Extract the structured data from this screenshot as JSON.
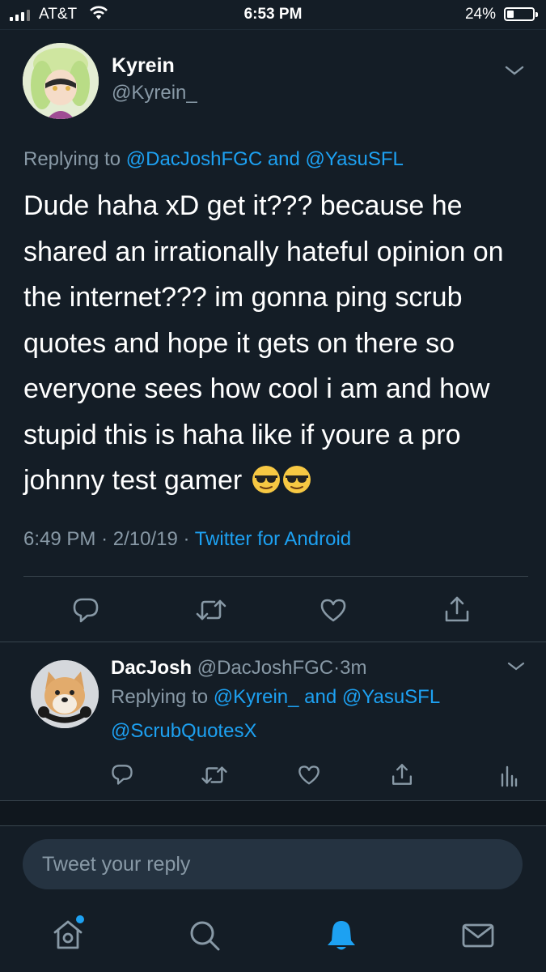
{
  "status_bar": {
    "carrier": "AT&T",
    "time": "6:53 PM",
    "battery": "24%"
  },
  "tweet": {
    "author_name": "Kyrein",
    "author_handle": "@Kyrein_",
    "replying_prefix": "Replying to",
    "replying_user1": "@DacJoshFGC",
    "replying_and": "and",
    "replying_user2": "@YasuSFL",
    "text": "Dude haha xD get it??? because he shared an irrationally hateful opinion on the internet??? im gonna ping scrub quotes and hope it gets on there so everyone sees how cool i am and how stupid this is haha like if youre a pro johnny test gamer",
    "emojis": [
      "smiling-face-with-sunglasses",
      "smiling-face-with-sunglasses"
    ],
    "time": "6:49 PM",
    "date": "2/10/19",
    "separator": "·",
    "source": "Twitter for Android"
  },
  "reply": {
    "author_name": "DacJosh",
    "author_handle": "@DacJoshFGC",
    "age": "3m",
    "separator": "·",
    "replying_prefix": "Replying to",
    "replying_user1": "@Kyrein_",
    "replying_and": "and",
    "replying_user2": "@YasuSFL",
    "text": "@ScrubQuotesX"
  },
  "composer": {
    "placeholder": "Tweet your reply"
  },
  "nav": {
    "items": [
      "home-icon",
      "search-icon",
      "notifications-icon",
      "messages-icon"
    ],
    "active": "notifications-icon"
  },
  "colors": {
    "background": "#141d26",
    "accent": "#1da1f2",
    "muted": "#8899a6",
    "divider": "#38444d"
  }
}
